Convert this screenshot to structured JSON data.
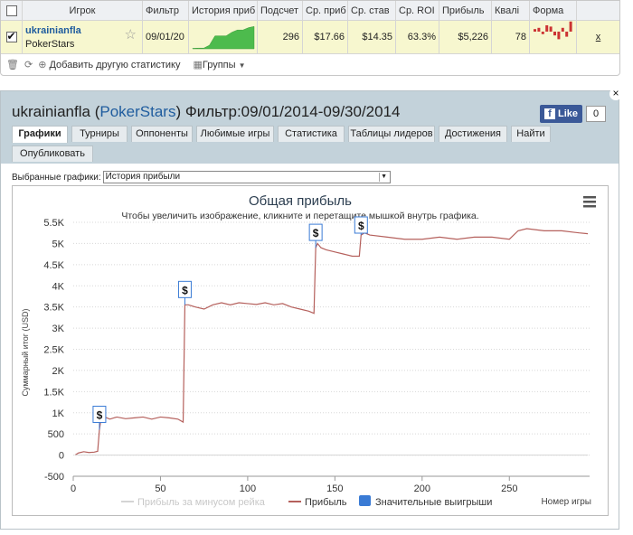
{
  "stats_table": {
    "headers": [
      "Игрок",
      "Фильтр",
      "История приб",
      "Подсчет",
      "Ср. приб",
      "Ср. став",
      "Ср. ROI",
      "Прибыль",
      "Квалі",
      "Форма"
    ],
    "row": {
      "player_name": "ukrainianfla",
      "site": "PokerStars",
      "filter": "09/01/20",
      "count": "296",
      "avg_profit": "$17.66",
      "avg_stake": "$14.35",
      "avg_roi": "63.3%",
      "profit": "$5,226",
      "quality": "78",
      "remove": "x"
    },
    "toolbar": {
      "add_stats": "Добавить другую статистику",
      "groups": "Группы"
    }
  },
  "panel": {
    "title_player": "ukrainianfla",
    "title_open": "(",
    "title_site": "PokerStars",
    "title_rest": ") Фильтр:09/01/2014-09/30/2014",
    "close": "×",
    "fb_like": "Like",
    "fb_count": "0",
    "tabs": [
      "Графики",
      "Турниры",
      "Оппоненты",
      "Любимые игры",
      "Статистика",
      "Таблицы лидеров",
      "Достижения",
      "Найти",
      "Опубликовать"
    ],
    "chart_select_label": "Выбранные графики:",
    "chart_select_value": "История прибыли"
  },
  "colors": {
    "profit_line": "#b5605c",
    "rake_line": "#d4d4d4",
    "marker": "#3a7bd5",
    "spark_green": "#4dbb4d",
    "form_red": "#cc3333"
  },
  "chart_data": {
    "type": "line",
    "title": "Общая прибыль",
    "subtitle": "Чтобы увеличить изображение, кликните и перетащите мышкой внутрь графика.",
    "xlabel": "Номер игры",
    "ylabel": "Суммарный итог (USD)",
    "xlim": [
      0,
      296
    ],
    "ylim": [
      -500,
      5500
    ],
    "x_ticks": [
      0,
      50,
      100,
      150,
      200,
      250
    ],
    "y_ticks": [
      -500,
      0,
      500,
      1000,
      1500,
      2000,
      2500,
      3000,
      3500,
      4000,
      4500,
      5000,
      5500
    ],
    "y_tick_labels": [
      "-500",
      "0",
      "500",
      "1K",
      "1.5K",
      "2K",
      "2.5K",
      "3K",
      "3.5K",
      "4K",
      "4.5K",
      "5K",
      "5.5K"
    ],
    "legend": [
      "Прибыль за минусом рейка",
      "Прибыль",
      "Значительные выигрыши"
    ],
    "legend_placement": "bottom",
    "grid": true,
    "marker_label": "$",
    "series": [
      {
        "name": "Прибыль",
        "x": [
          1,
          3,
          6,
          9,
          12,
          14,
          15,
          16,
          18,
          21,
          25,
          30,
          35,
          40,
          45,
          50,
          55,
          60,
          63,
          64,
          66,
          70,
          75,
          80,
          85,
          90,
          95,
          100,
          105,
          110,
          115,
          120,
          125,
          130,
          135,
          138,
          139,
          140,
          142,
          145,
          150,
          155,
          160,
          164,
          165,
          167,
          170,
          180,
          190,
          200,
          210,
          220,
          230,
          240,
          250,
          255,
          260,
          270,
          280,
          290,
          295
        ],
        "y": [
          0,
          50,
          80,
          60,
          70,
          90,
          600,
          880,
          900,
          850,
          900,
          860,
          880,
          900,
          850,
          900,
          880,
          850,
          780,
          3550,
          3550,
          3500,
          3450,
          3550,
          3600,
          3550,
          3600,
          3580,
          3560,
          3600,
          3550,
          3580,
          3500,
          3450,
          3400,
          3350,
          4900,
          5000,
          4900,
          4850,
          4800,
          4750,
          4700,
          4700,
          5200,
          5250,
          5200,
          5150,
          5100,
          5100,
          5150,
          5100,
          5150,
          5150,
          5100,
          5300,
          5350,
          5300,
          5300,
          5250,
          5230
        ]
      },
      {
        "name": "Прибыль за минусом рейка",
        "x": [
          1,
          295
        ],
        "y": [
          0,
          0
        ]
      }
    ],
    "big_wins": [
      {
        "x": 15
      },
      {
        "x": 64
      },
      {
        "x": 139
      },
      {
        "x": 165
      }
    ],
    "sparkline": [
      0.02,
      0.03,
      0.03,
      0.15,
      0.55,
      0.55,
      0.55,
      0.7,
      0.8,
      0.8,
      0.9,
      0.95
    ],
    "form": [
      0.2,
      0.3,
      -0.2,
      0.5,
      0.4,
      -0.3,
      -0.6,
      0.3,
      -0.4,
      0.8
    ]
  }
}
